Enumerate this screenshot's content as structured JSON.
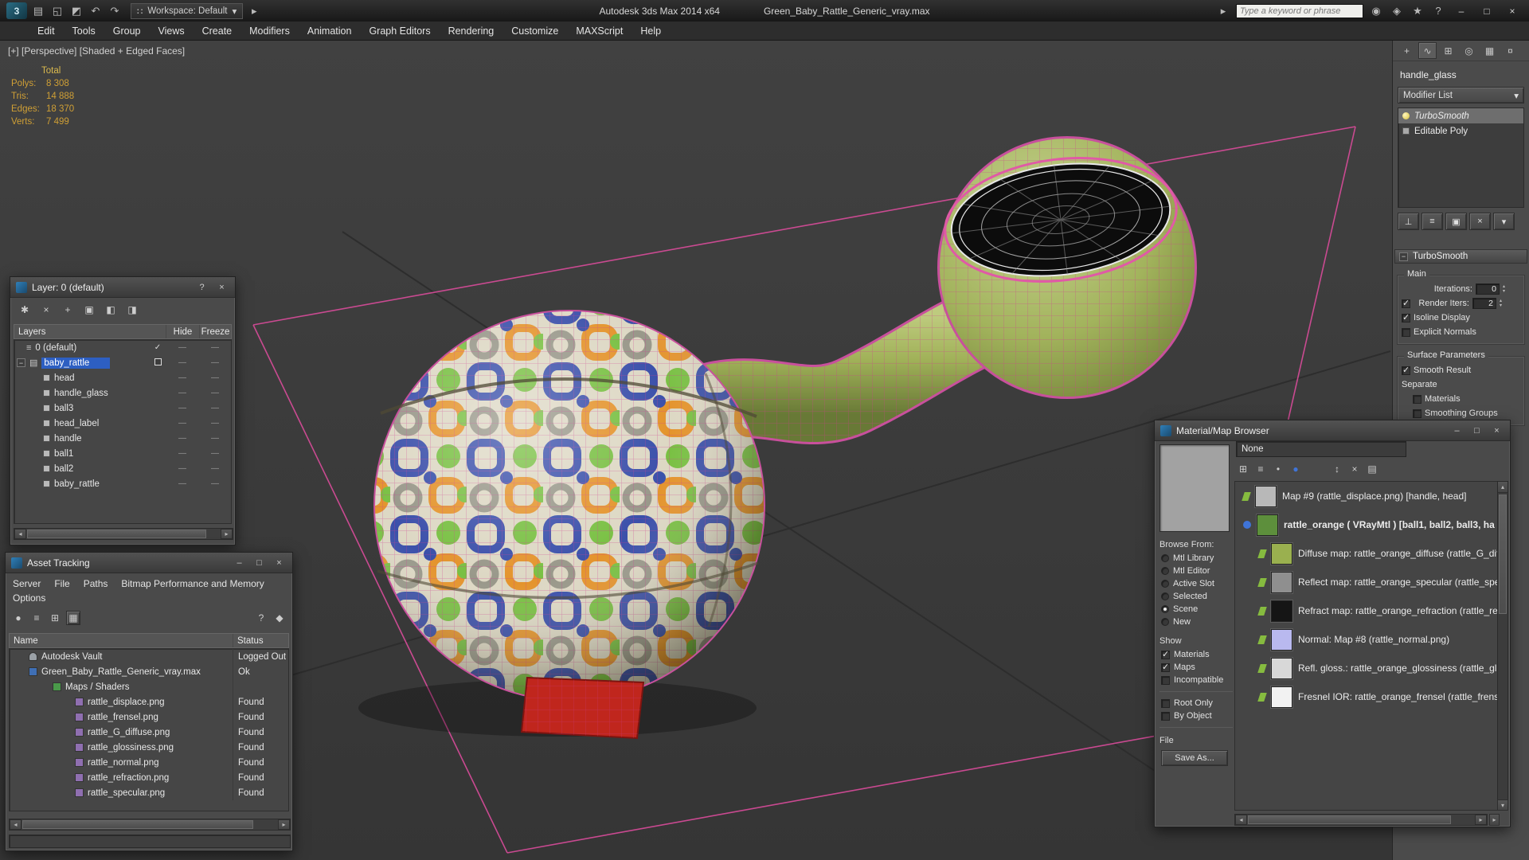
{
  "title_bar": {
    "app_title": "Autodesk 3ds Max 2014 x64",
    "file_name": "Green_Baby_Rattle_Generic_vray.max",
    "workspace": "Workspace: Default",
    "search_placeholder": "Type a keyword or phrase"
  },
  "window_controls": {
    "minimize": "–",
    "maximize": "□",
    "close": "×",
    "help": "?"
  },
  "icons": {
    "new_scene": "▤",
    "open_file": "◱",
    "save_file": "◩",
    "undo": "↶",
    "redo": "↷",
    "workspace_grip": "∷",
    "dropdown_arrow": "▾",
    "play_arrow": "▸",
    "binoculars": "◉",
    "infocenter": "◈",
    "favorites": "★",
    "tab_create": "+",
    "tab_modify": "∿",
    "tab_hierarchy": "⊞",
    "tab_motion": "◎",
    "tab_display": "▦",
    "tab_utilities": "¤",
    "pin_stack": "⊥",
    "show_end_result": "≡",
    "make_unique": "▣",
    "remove_modifier": "×",
    "configure_sets": "▾",
    "minus": "−",
    "spin_up": "▴",
    "spin_down": "▾",
    "lt_new": "✱",
    "lt_delete": "×",
    "lt_add": "+",
    "lt_select": "▣",
    "lt_current": "◧",
    "lt_highlight": "◨",
    "layer_glyph": "≡",
    "folder_glyph": "▤",
    "at_refresh": "●",
    "at_list": "≡",
    "at_grid": "⊞",
    "at_table": "▦",
    "at_help": "?",
    "at_lock": "◆",
    "mt_grid": "⊞",
    "mt_list": "≡",
    "mt_dot": "•",
    "mt_sphere": "●",
    "mt_sort": "↕",
    "mt_x": "×",
    "mt_doc": "▤",
    "arrow_left": "◂",
    "arrow_right": "▸",
    "arrow_up": "▴",
    "arrow_down": "▾"
  },
  "menu_bar": {
    "items": [
      "Edit",
      "Tools",
      "Group",
      "Views",
      "Create",
      "Modifiers",
      "Animation",
      "Graph Editors",
      "Rendering",
      "Customize",
      "MAXScript",
      "Help"
    ]
  },
  "viewport": {
    "label": "[+] [Perspective] [Shaded + Edged Faces]",
    "stats": {
      "total_label": "Total",
      "rows": [
        {
          "label": "Polys:",
          "value": "8 308"
        },
        {
          "label": "Tris:",
          "value": "14 888"
        },
        {
          "label": "Edges:",
          "value": "18 370"
        },
        {
          "label": "Verts:",
          "value": "7 499"
        }
      ]
    }
  },
  "layer_dialog": {
    "title": "Layer: 0 (default)",
    "columns": {
      "layers": "Layers",
      "hide": "Hide",
      "freeze": "Freeze"
    },
    "dash": "—",
    "check": "✓",
    "rows": [
      {
        "label": "0 (default)",
        "current": true
      },
      {
        "label": "baby_rattle",
        "selected": true
      },
      {
        "label": "head"
      },
      {
        "label": "handle_glass"
      },
      {
        "label": "ball3"
      },
      {
        "label": "head_label"
      },
      {
        "label": "handle"
      },
      {
        "label": "ball1"
      },
      {
        "label": "ball2"
      },
      {
        "label": "baby_rattle"
      }
    ]
  },
  "asset_dialog": {
    "title": "Asset Tracking",
    "menu_items": [
      "Server",
      "File",
      "Paths",
      "Bitmap Performance and Memory",
      "Options"
    ],
    "columns": {
      "name": "Name",
      "status": "Status"
    },
    "rows": [
      {
        "name": "Autodesk Vault",
        "status": "Logged Out"
      },
      {
        "name": "Green_Baby_Rattle_Generic_vray.max",
        "status": "Ok"
      },
      {
        "name": "Maps / Shaders",
        "status": ""
      },
      {
        "name": "rattle_displace.png",
        "status": "Found"
      },
      {
        "name": "rattle_frensel.png",
        "status": "Found"
      },
      {
        "name": "rattle_G_diffuse.png",
        "status": "Found"
      },
      {
        "name": "rattle_glossiness.png",
        "status": "Found"
      },
      {
        "name": "rattle_normal.png",
        "status": "Found"
      },
      {
        "name": "rattle_refraction.png",
        "status": "Found"
      },
      {
        "name": "rattle_specular.png",
        "status": "Found"
      }
    ]
  },
  "material_browser": {
    "title": "Material/Map Browser",
    "search_value": "None",
    "entries": [
      {
        "text": "Map #9 (rattle_displace.png)  [handle, head]",
        "thumb": "#b8b8b8",
        "bold": false,
        "indent": 0,
        "marker": "map"
      },
      {
        "text": "rattle_orange ( VRayMtl ) [ball1, ball2, ball3, ha",
        "thumb": "#5d8f3c",
        "bold": true,
        "indent": 0,
        "marker": "material"
      },
      {
        "text": "Diffuse map: rattle_orange_diffuse (rattle_G_diffuse",
        "thumb": "#9ab04f",
        "bold": false,
        "indent": 1,
        "marker": "map"
      },
      {
        "text": "Reflect map: rattle_orange_specular (rattle_specular",
        "thumb": "#8f8f8f",
        "bold": false,
        "indent": 1,
        "marker": "map"
      },
      {
        "text": "Refract map: rattle_orange_refraction (rattle_refrac",
        "thumb": "#151515",
        "bold": false,
        "indent": 1,
        "marker": "map"
      },
      {
        "text": "Normal: Map #8 (rattle_normal.png)",
        "thumb": "#b9b9ef",
        "bold": false,
        "indent": 1,
        "marker": "map"
      },
      {
        "text": "Refl. gloss.: rattle_orange_glossiness (rattle_glossin",
        "thumb": "#d8d8d8",
        "bold": false,
        "indent": 1,
        "marker": "map"
      },
      {
        "text": "Fresnel IOR: rattle_orange_frensel (rattle_frensel.p",
        "thumb": "#f2f2f2",
        "bold": false,
        "indent": 1,
        "marker": "map"
      }
    ],
    "browse_from": {
      "label": "Browse From:",
      "options": [
        {
          "label": "Mtl Library",
          "checked": false
        },
        {
          "label": "Mtl Editor",
          "checked": false
        },
        {
          "label": "Active Slot",
          "checked": false
        },
        {
          "label": "Selected",
          "checked": false
        },
        {
          "label": "Scene",
          "checked": true
        },
        {
          "label": "New",
          "checked": false
        }
      ]
    },
    "show": {
      "label": "Show",
      "options": [
        {
          "label": "Materials",
          "checked": true
        },
        {
          "label": "Maps",
          "checked": true
        },
        {
          "label": "Incompatible",
          "checked": false
        }
      ],
      "options2": [
        {
          "label": "Root Only",
          "checked": false
        },
        {
          "label": "By Object",
          "checked": false
        }
      ]
    },
    "file_section": {
      "label": "File",
      "save_as": "Save As..."
    }
  },
  "command_panel": {
    "object_name": "handle_glass",
    "modifier_list": "Modifier List",
    "stack": [
      {
        "label": "TurboSmooth",
        "selected": true
      },
      {
        "label": "Editable Poly",
        "selected": false
      }
    ],
    "rollout_title": "TurboSmooth",
    "main_group": {
      "label": "Main",
      "iterations_label": "Iterations:",
      "iterations_value": "0",
      "render_iters_label": "Render Iters:",
      "render_iters_value": "2",
      "render_iters_checked": true,
      "isoline_label": "Isoline Display",
      "isoline_checked": true,
      "explicit_label": "Explicit Normals",
      "explicit_checked": false
    },
    "surface_group": {
      "label": "Surface Parameters",
      "smooth_result_label": "Smooth Result",
      "smooth_result_checked": true,
      "separate_label": "Separate",
      "materials_label": "Materials",
      "materials_checked": false,
      "smoothing_label": "Smoothing Groups",
      "smoothing_checked": false
    }
  }
}
